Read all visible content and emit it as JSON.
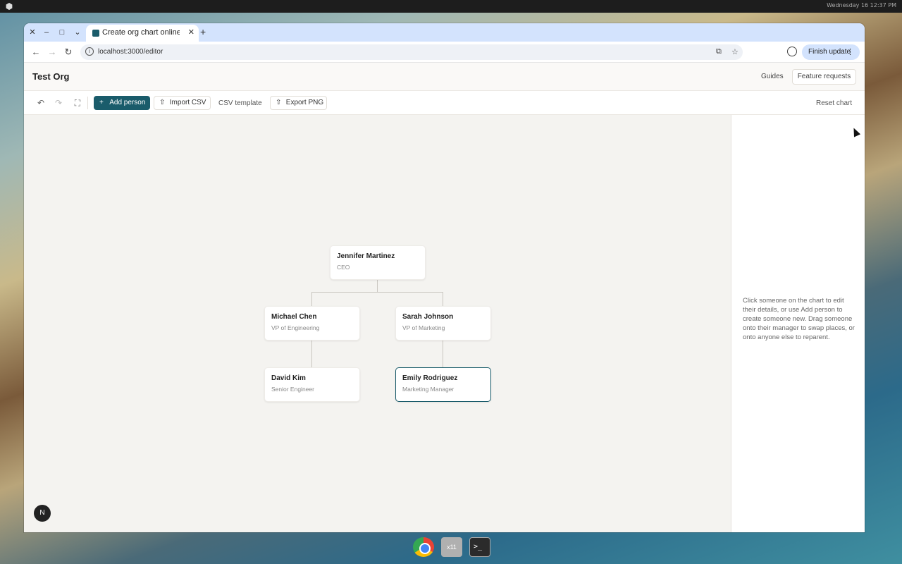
{
  "desktop": {
    "clock": "Wednesday 16  12:37 PM"
  },
  "browser": {
    "tab_title": "Create org chart online",
    "url": "localhost:3000/editor",
    "finish_update_label": "Finish update"
  },
  "app": {
    "org_title": "Test Org",
    "guides_label": "Guides",
    "feature_requests_label": "Feature requests"
  },
  "toolbar": {
    "add_person_label": "Add person",
    "import_csv_label": "Import CSV",
    "csv_template_label": "CSV template",
    "export_png_label": "Export PNG",
    "reset_chart_label": "Reset chart"
  },
  "chart": {
    "people": [
      {
        "name": "Jennifer Martinez",
        "role": "CEO"
      },
      {
        "name": "Michael Chen",
        "role": "VP of Engineering"
      },
      {
        "name": "Sarah Johnson",
        "role": "VP of Marketing"
      },
      {
        "name": "David Kim",
        "role": "Senior Engineer"
      },
      {
        "name": "Emily Rodriguez",
        "role": "Marketing Manager",
        "selected": true
      }
    ]
  },
  "side_panel": {
    "help_text": "Click someone on the chart to edit their details, or use Add person to create someone new. Drag someone onto their manager to swap places, or onto anyone else to reparent."
  },
  "dev_badge": "N",
  "dock": {
    "x_label": "x11"
  },
  "colors": {
    "accent": "#1a5c6b",
    "canvas_bg": "#f4f3f0"
  }
}
